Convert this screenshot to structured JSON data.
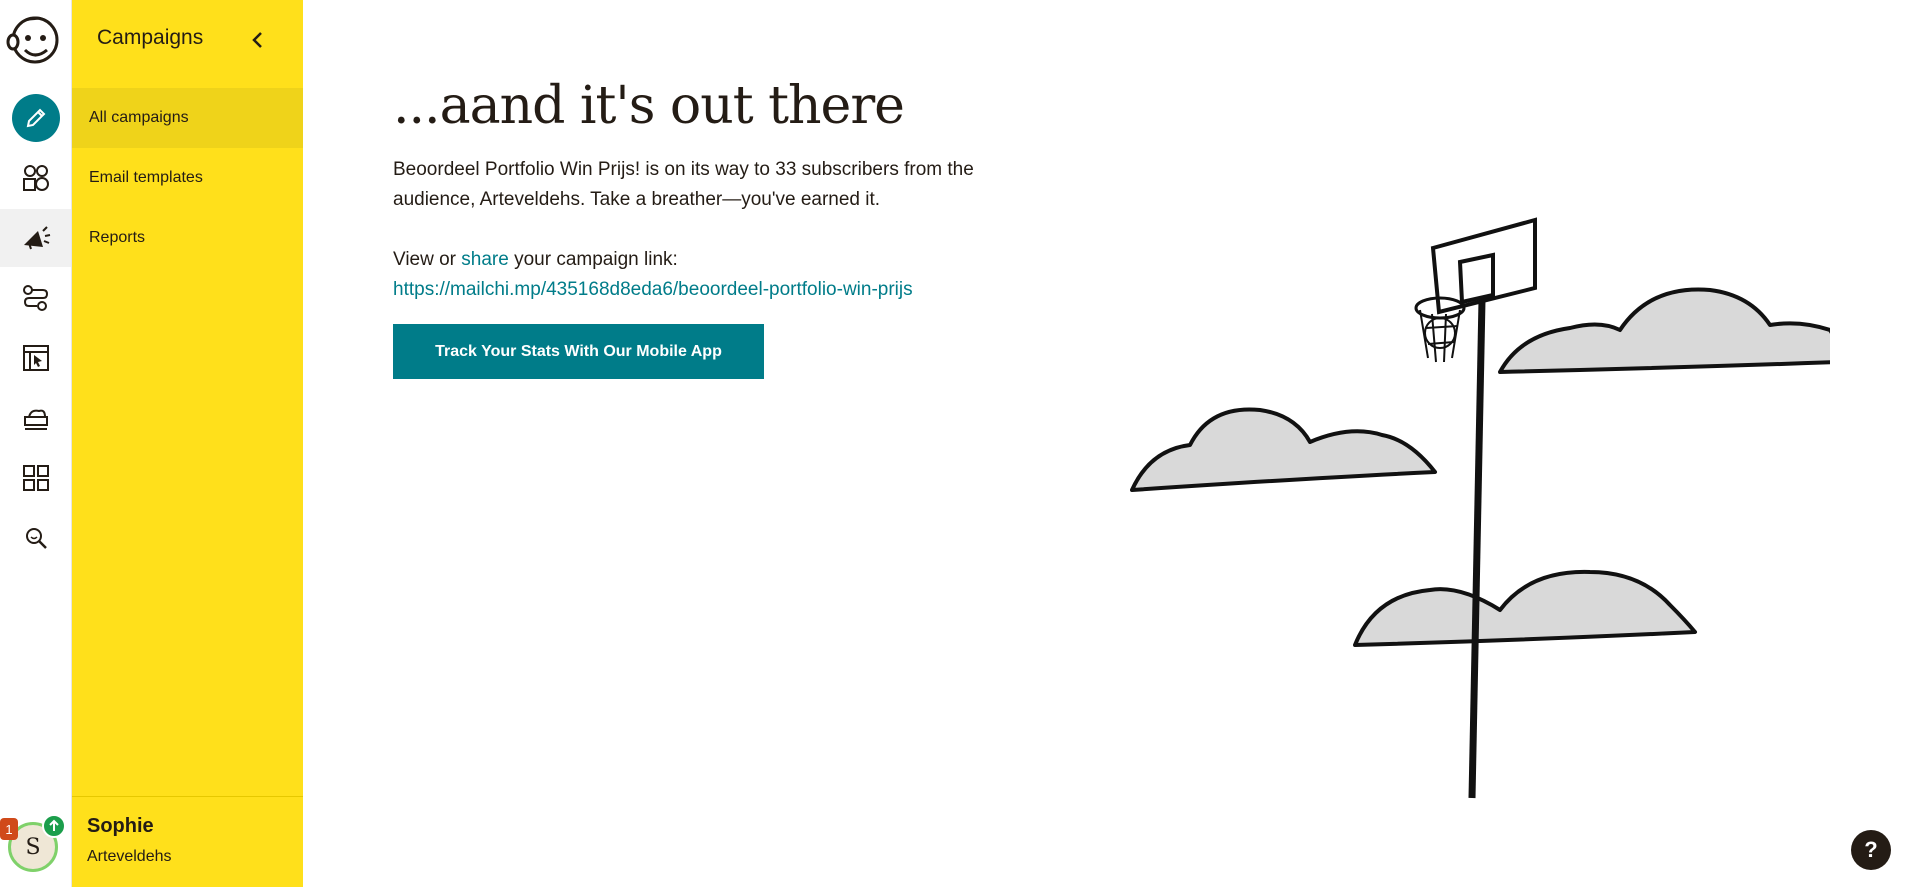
{
  "sidenav": {
    "title": "Campaigns",
    "items": [
      {
        "label": "All campaigns",
        "selected": true
      },
      {
        "label": "Email templates",
        "selected": false
      },
      {
        "label": "Reports",
        "selected": false
      }
    ]
  },
  "rail": {
    "icons": [
      "mailchimp-logo",
      "create-pencil-icon",
      "audience-icon",
      "campaigns-megaphone-icon",
      "automations-icon",
      "website-icon",
      "content-studio-icon",
      "integrations-grid-icon",
      "search-icon"
    ],
    "accent_color": "#007c89"
  },
  "user": {
    "initial": "S",
    "name": "Sophie",
    "org": "Arteveldehs",
    "notification_count": "1"
  },
  "main": {
    "title": "...aand it's out there",
    "lead_text": "Beoordeel Portfolio Win Prijs! is on its way to 33 subscribers from the audience, Arteveldehs. Take a breather—you've earned it.",
    "link_prefix": "View or ",
    "share_link": "share",
    "link_suffix": " your campaign link:",
    "campaign_url": "https://mailchi.mp/435168d8eda6/beoordeel-portfolio-win-prijs",
    "cta_label": "Track Your Stats With Our Mobile App"
  },
  "help": {
    "label": "?"
  },
  "colors": {
    "sidenav_bg": "#ffe01b",
    "selected_bg": "#efd31a",
    "teal": "#007c89",
    "text": "#241c15"
  }
}
